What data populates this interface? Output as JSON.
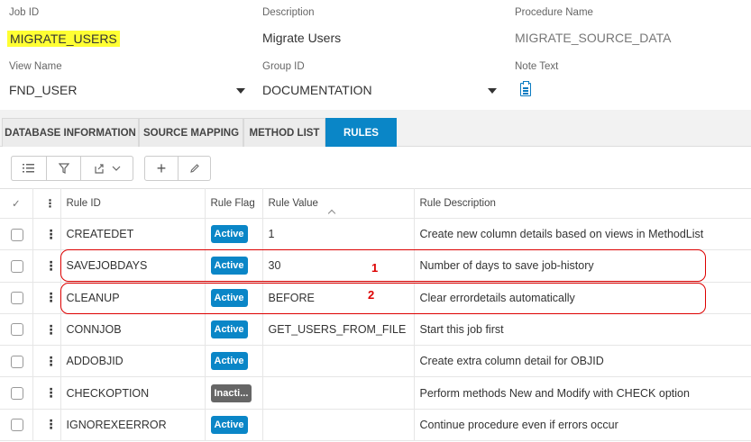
{
  "header": {
    "job_id": {
      "label": "Job ID",
      "value": "MIGRATE_USERS"
    },
    "description": {
      "label": "Description",
      "value": "Migrate Users"
    },
    "procedure_name": {
      "label": "Procedure Name",
      "value": "MIGRATE_SOURCE_DATA"
    },
    "view_name": {
      "label": "View Name",
      "value": "FND_USER"
    },
    "group_id": {
      "label": "Group ID",
      "value": "DOCUMENTATION"
    },
    "note_text": {
      "label": "Note Text",
      "icon": "note-icon"
    }
  },
  "tabs": [
    {
      "label": "DATABASE INFORMATION",
      "active": false
    },
    {
      "label": "SOURCE MAPPING",
      "active": false
    },
    {
      "label": "METHOD LIST",
      "active": false
    },
    {
      "label": "RULES",
      "active": true
    }
  ],
  "toolbar": {
    "icons": [
      "list-settings-icon",
      "filter-icon",
      "export-icon",
      "chevron-down-icon",
      "add-icon",
      "edit-icon"
    ],
    "add_label": "+"
  },
  "table": {
    "columns": [
      "Rule ID",
      "Rule Flag",
      "Rule Value",
      "Rule Description"
    ],
    "rows": [
      {
        "rule_id": "CREATEDET",
        "flag": "Active",
        "value": "1",
        "description": "Create new column details based on views in MethodList"
      },
      {
        "rule_id": "SAVEJOBDAYS",
        "flag": "Active",
        "value": "30",
        "description": "Number of days to save job-history"
      },
      {
        "rule_id": "CLEANUP",
        "flag": "Active",
        "value": "BEFORE",
        "description": "Clear errordetails automatically"
      },
      {
        "rule_id": "CONNJOB",
        "flag": "Active",
        "value": "GET_USERS_FROM_FILE",
        "description": "Start this job first"
      },
      {
        "rule_id": "ADDOBJID",
        "flag": "Active",
        "value": "",
        "description": "Create extra column detail for OBJID"
      },
      {
        "rule_id": "CHECKOPTION",
        "flag": "Inacti...",
        "value": "",
        "description": "Perform methods New and Modify with CHECK option"
      },
      {
        "rule_id": "IGNOREXEERROR",
        "flag": "Active",
        "value": "",
        "description": "Continue procedure even if errors occur"
      }
    ]
  },
  "callouts": [
    {
      "number": "1"
    },
    {
      "number": "2"
    }
  ],
  "colors": {
    "accent": "#0a86c7",
    "highlight": "#ffff33",
    "callout": "#dd0000",
    "inactive": "#666666"
  }
}
